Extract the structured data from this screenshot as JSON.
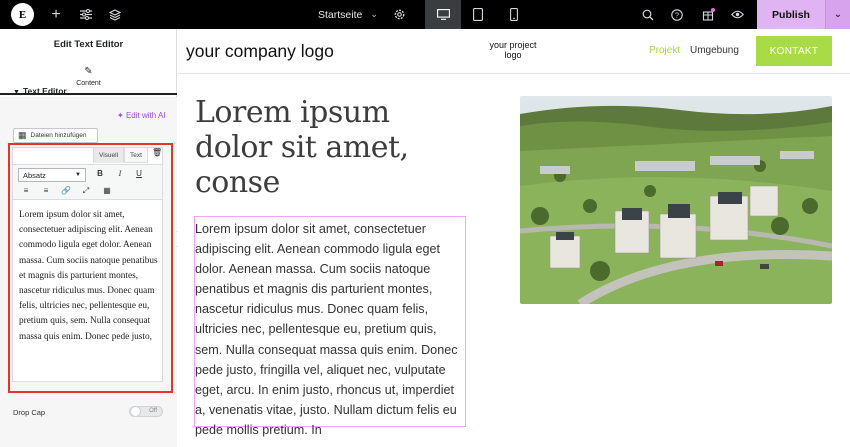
{
  "topbar": {
    "page_name": "Startseite",
    "publish_label": "Publish",
    "icons": [
      "elementor-logo-icon",
      "plus-icon",
      "sliders-icon",
      "layers-icon",
      "gear-icon",
      "desktop-icon",
      "tablet-icon",
      "mobile-icon",
      "search-icon",
      "help-icon",
      "gift-icon",
      "eye-icon",
      "chevron-down-icon"
    ],
    "accent_color": "#e0b3f3"
  },
  "panel": {
    "title": "Edit Text Editor",
    "tab_label": "Content",
    "section_title": "Text Editor",
    "edit_ai_label": "Edit with AI",
    "add_files_label": "Dateien hinzufügen",
    "editor": {
      "tab_visual": "Visuell",
      "tab_text": "Text",
      "format_value": "Absatz",
      "bold": "B",
      "italic": "I",
      "underline": "U",
      "content": "Lorem ipsum dolor sit amet, consectetuer adipiscing elit. Aenean commodo ligula eget dolor. Aenean massa. Cum sociis natoque penatibus et magnis dis parturient montes, nascetur ridiculus mus. Donec quam felis, ultricies nec, pellentesque eu, pretium quis, sem. Nulla consequat massa quis enim. Donec pede justo,"
    },
    "dropcap_label": "Drop Cap",
    "dropcap_state": "Off"
  },
  "site": {
    "logo": "your company logo",
    "project_logo_line1": "your project",
    "project_logo_line2": "logo",
    "nav_projekt": "Projekt",
    "nav_umgebung": "Umgebung",
    "kontakt_label": "KONTAKT",
    "hero_title": "Lorem ipsum dolor sit amet, conse",
    "body_text": "Lorem ipsum dolor sit amet, consectetuer adipiscing elit. Aenean commodo ligula eget dolor. Aenean massa. Cum sociis natoque penatibus et magnis dis parturient montes, nascetur ridiculus mus. Donec quam felis, ultricies nec, pellentesque eu, pretium quis, sem. Nulla consequat massa quis enim. Donec pede justo, fringilla vel, aliquet nec, vulputate eget, arcu. In enim justo, rhoncus ut, imperdiet a, venenatis vitae, justo. Nullam dictum felis eu pede mollis pretium. In",
    "accent_color": "#a8db45"
  }
}
